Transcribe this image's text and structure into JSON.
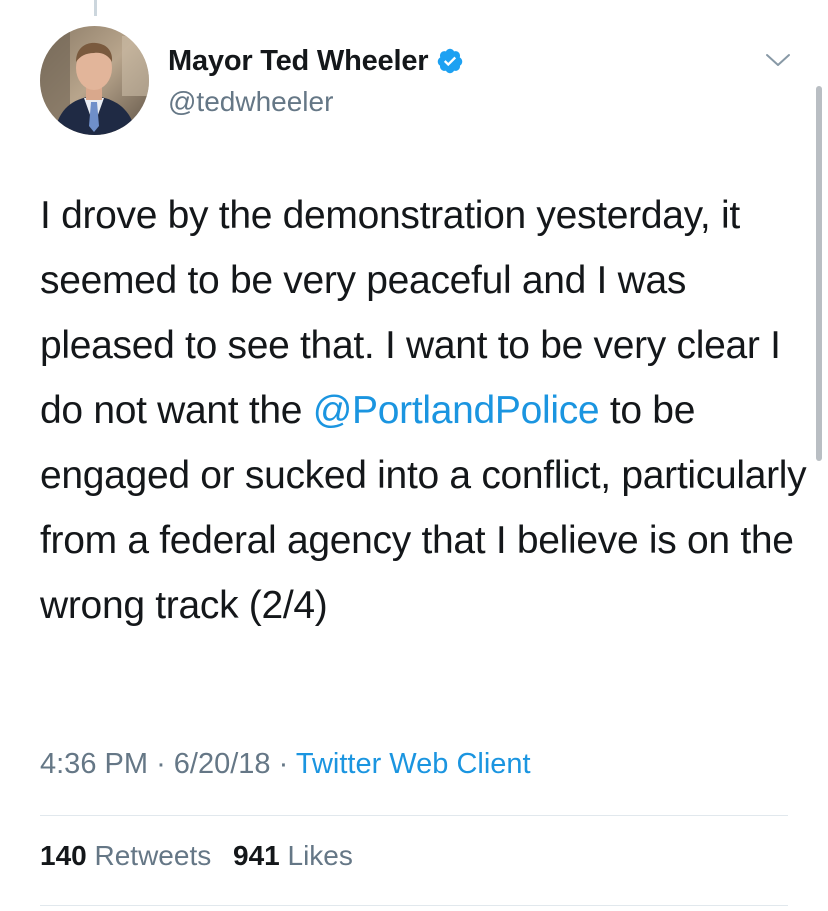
{
  "tweet": {
    "author": {
      "display_name": "Mayor Ted Wheeler",
      "handle": "@tedwheeler",
      "verified": true,
      "avatar_icon": "person-portrait-photo"
    },
    "text": {
      "part1": "I drove by the demonstration yesterday, it seemed to be very peaceful and I was pleased to see that. I want to be very clear I do not want the ",
      "mention": "@PortlandPolice",
      "part2": " to be engaged or sucked into a conflict, particularly from a federal agency that I believe is on the wrong track (2/4)"
    },
    "meta": {
      "time": "4:36 PM",
      "separator": "·",
      "date": "6/20/18",
      "source": "Twitter Web Client"
    },
    "stats": {
      "retweets_count": "140",
      "retweets_label": "Retweets",
      "likes_count": "941",
      "likes_label": "Likes"
    }
  },
  "colors": {
    "link_blue": "#1b95e0",
    "secondary_gray": "#657786",
    "verified_blue": "#1da1f2",
    "divider": "#e1e8ed"
  }
}
